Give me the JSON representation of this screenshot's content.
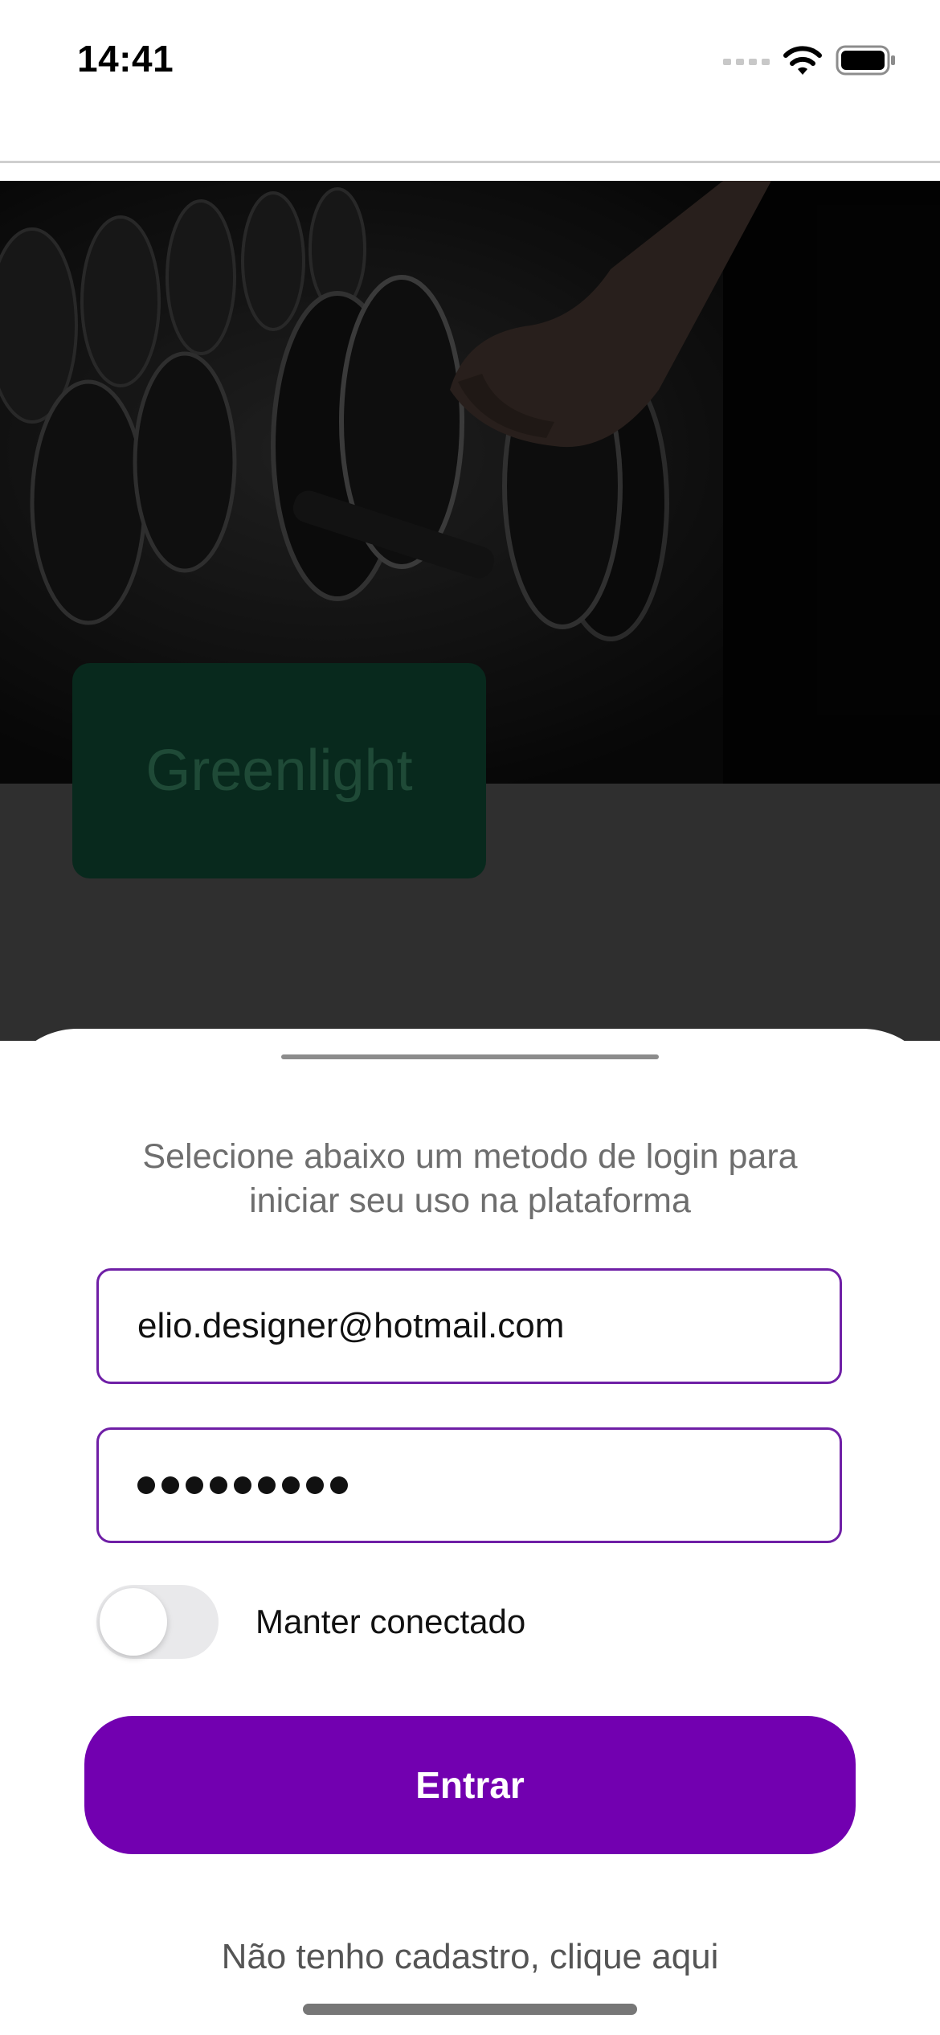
{
  "status_bar": {
    "time": "14:41",
    "icons": [
      "signal-icon",
      "wifi-icon",
      "battery-icon"
    ]
  },
  "hero": {
    "image": "gym-dumbbells-photo",
    "brand_label": "Greenlight"
  },
  "login_sheet": {
    "subtitle_line1": "Selecione abaixo um metodo de login para",
    "subtitle_line2": "iniciar seu uso na plataforma",
    "email_value": "elio.designer@hotmail.com",
    "password_masked": "•••••••••",
    "keep_connected_label": "Manter conectado",
    "keep_connected_on": false,
    "submit_label": "Entrar",
    "signup_link": "Não tenho cadastro, clique aqui"
  },
  "colors": {
    "accent": "#7200b0",
    "field_border": "#6f1fa6",
    "brand_bg": "#08291d"
  }
}
